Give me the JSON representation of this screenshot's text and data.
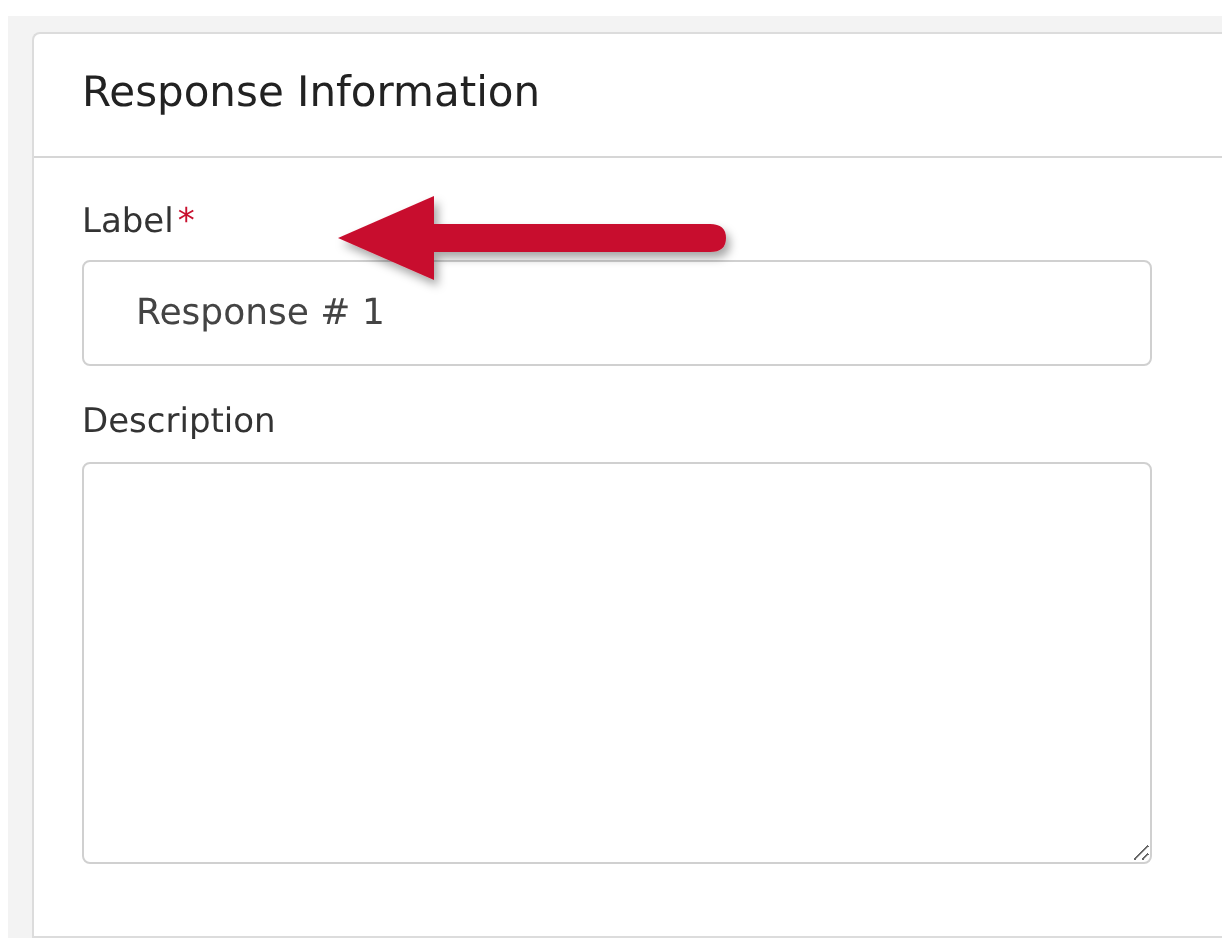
{
  "panel": {
    "title": "Response Information"
  },
  "fields": [
    {
      "kind": "input",
      "label": "Label",
      "required_mark": "*",
      "value": "Response # 1"
    },
    {
      "kind": "textarea",
      "label": "Description"
    }
  ],
  "annotations": [
    {
      "kind": "arrow"
    }
  ]
}
